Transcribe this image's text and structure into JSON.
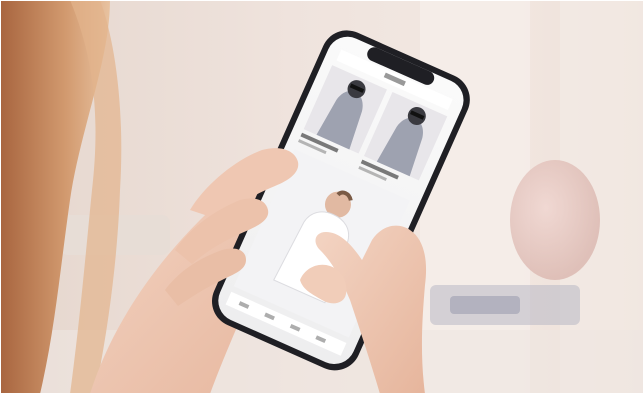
{
  "scene": {
    "description_visible_text": "",
    "phone_app": {
      "status_bar_title": "",
      "products": [
        {
          "name": "",
          "price": ""
        },
        {
          "name": "",
          "price": ""
        }
      ]
    },
    "colors": {
      "background_wall": "#eee1db",
      "phone_frame": "#1f1f24",
      "screen_bg": "#f5f5f7",
      "skin": "#f0c9b5",
      "hair": "#c7865d",
      "jacket_gray": "#9ea2b0"
    }
  }
}
